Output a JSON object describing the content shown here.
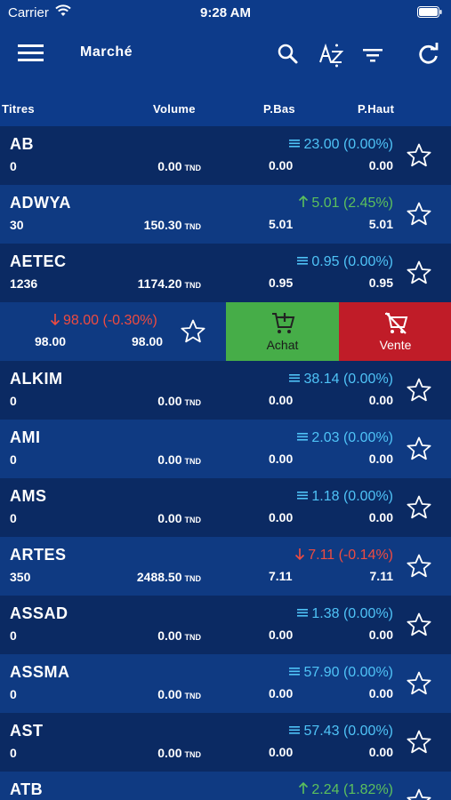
{
  "status": {
    "carrier": "Carrier",
    "time": "9:28 AM"
  },
  "navbar": {
    "title": "Marché"
  },
  "columns": {
    "titres": "Titres",
    "volume": "Volume",
    "pbas": "P.Bas",
    "phaut": "P.Haut"
  },
  "actions": {
    "buy_label": "Achat",
    "sell_label": "Vente"
  },
  "currency": "TND",
  "rows": [
    {
      "symbol": "AB",
      "qty": "0",
      "volume": "0.00",
      "price": "23.00 (0.00%)",
      "trend": "flat",
      "low": "0.00",
      "high": "0.00"
    },
    {
      "symbol": "ADWYA",
      "qty": "30",
      "volume": "150.30",
      "price": "5.01 (2.45%)",
      "trend": "up",
      "low": "5.01",
      "high": "5.01"
    },
    {
      "symbol": "AETEC",
      "qty": "1236",
      "volume": "1174.20",
      "price": "0.95 (0.00%)",
      "trend": "flat",
      "low": "0.95",
      "high": "0.95"
    },
    {
      "symbol": "",
      "qty": "",
      "volume": "",
      "price": "98.00 (-0.30%)",
      "trend": "down",
      "low": "98.00",
      "high": "98.00",
      "swiped": true
    },
    {
      "symbol": "ALKIM",
      "qty": "0",
      "volume": "0.00",
      "price": "38.14 (0.00%)",
      "trend": "flat",
      "low": "0.00",
      "high": "0.00"
    },
    {
      "symbol": "AMI",
      "qty": "0",
      "volume": "0.00",
      "price": "2.03 (0.00%)",
      "trend": "flat",
      "low": "0.00",
      "high": "0.00"
    },
    {
      "symbol": "AMS",
      "qty": "0",
      "volume": "0.00",
      "price": "1.18 (0.00%)",
      "trend": "flat",
      "low": "0.00",
      "high": "0.00"
    },
    {
      "symbol": "ARTES",
      "qty": "350",
      "volume": "2488.50",
      "price": "7.11 (-0.14%)",
      "trend": "down",
      "low": "7.11",
      "high": "7.11"
    },
    {
      "symbol": "ASSAD",
      "qty": "0",
      "volume": "0.00",
      "price": "1.38 (0.00%)",
      "trend": "flat",
      "low": "0.00",
      "high": "0.00"
    },
    {
      "symbol": "ASSMA",
      "qty": "0",
      "volume": "0.00",
      "price": "57.90 (0.00%)",
      "trend": "flat",
      "low": "0.00",
      "high": "0.00"
    },
    {
      "symbol": "AST",
      "qty": "0",
      "volume": "0.00",
      "price": "57.43 (0.00%)",
      "trend": "flat",
      "low": "0.00",
      "high": "0.00"
    },
    {
      "symbol": "ATB",
      "qty": "",
      "volume": "",
      "price": "2.24 (1.82%)",
      "trend": "up",
      "low": "",
      "high": ""
    }
  ],
  "colors": {
    "flat": "#4fc3f7",
    "up": "#5cc05c",
    "down": "#ef4b40",
    "buy": "#46ad48",
    "sell": "#c01c28"
  },
  "icons": {
    "menu": "hamburger-icon",
    "search": "search-icon",
    "sort": "sort-az-icon",
    "filter": "filter-icon",
    "refresh": "refresh-icon",
    "favorite": "star-icon",
    "buy": "cart-add-icon",
    "sell": "cart-remove-icon"
  }
}
